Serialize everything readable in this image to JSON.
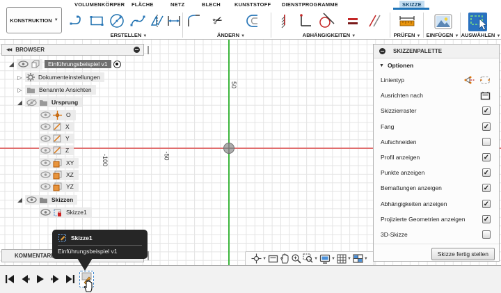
{
  "glyphs": {
    "check": "✓",
    "caret": "▾",
    "tri_open": "◢",
    "tri_closed": "▷",
    "collapse": "◀◀"
  },
  "ribbon": {
    "konstruktion_label": "KONSTRUKTION",
    "tabs": [
      {
        "label": "VOLUMENKÖRPER",
        "active": false
      },
      {
        "label": "FLÄCHE",
        "active": false
      },
      {
        "label": "NETZ",
        "active": false
      },
      {
        "label": "BLECH",
        "active": false
      },
      {
        "label": "KUNSTSTOFF",
        "active": false
      },
      {
        "label": "DIENSTPROGRAMME",
        "active": false
      },
      {
        "label": "SKIZZE",
        "active": true
      }
    ],
    "groups": [
      {
        "label": "ERSTELLEN"
      },
      {
        "label": "ÄNDERN"
      },
      {
        "label": "ABHÄNGIGKEITEN"
      },
      {
        "label": "PRÜFEN"
      },
      {
        "label": "EINFÜGEN"
      },
      {
        "label": "AUSWÄHLEN"
      }
    ]
  },
  "browser": {
    "title": "BROWSER",
    "comments_label": "KOMMENTARE",
    "items": [
      {
        "label": "Einführungsbeispiel v1"
      },
      {
        "label": "Dokumenteinstellungen"
      },
      {
        "label": "Benannte Ansichten"
      },
      {
        "label": "Ursprung"
      },
      {
        "label": "O"
      },
      {
        "label": "X"
      },
      {
        "label": "Y"
      },
      {
        "label": "Z"
      },
      {
        "label": "XY"
      },
      {
        "label": "XZ"
      },
      {
        "label": "YZ"
      },
      {
        "label": "Skizzen"
      },
      {
        "label": "Skizze1"
      }
    ]
  },
  "canvas": {
    "tick_y_50": "50",
    "tick_x_neg50": "-50",
    "tick_x_neg100": "-100"
  },
  "tooltip": {
    "title": "Skizze1",
    "subtitle": "Einführungsbeispiel v1"
  },
  "palette": {
    "title": "SKIZZENPALETTE",
    "section": "Optionen",
    "options": [
      {
        "label": "Linientyp",
        "control": "icons"
      },
      {
        "label": "Ausrichten nach",
        "control": "icon"
      },
      {
        "label": "Skizzierraster",
        "checked": true
      },
      {
        "label": "Fang",
        "checked": true
      },
      {
        "label": "Aufschneiden",
        "checked": false
      },
      {
        "label": "Profil anzeigen",
        "checked": true
      },
      {
        "label": "Punkte anzeigen",
        "checked": true
      },
      {
        "label": "Bemaßungen anzeigen",
        "checked": true
      },
      {
        "label": "Abhängigkeiten anzeigen",
        "checked": true
      },
      {
        "label": "Projizierte Geometrien anzeigen",
        "checked": true
      },
      {
        "label": "3D-Skizze",
        "checked": false
      }
    ],
    "finish_button": "Skizze fertig stellen"
  },
  "colors": {
    "accent_blue": "#1f74b8",
    "tab_active_bg": "#c3ddf1",
    "axis_green": "#3db53d",
    "axis_red": "#e06e6e",
    "tool_blue": "#1b6fae",
    "constraint_red": "#c42727",
    "measure_orange": "#e8940c",
    "selection_gray": "#6f6f6f",
    "tooltip_bg": "#262626"
  }
}
